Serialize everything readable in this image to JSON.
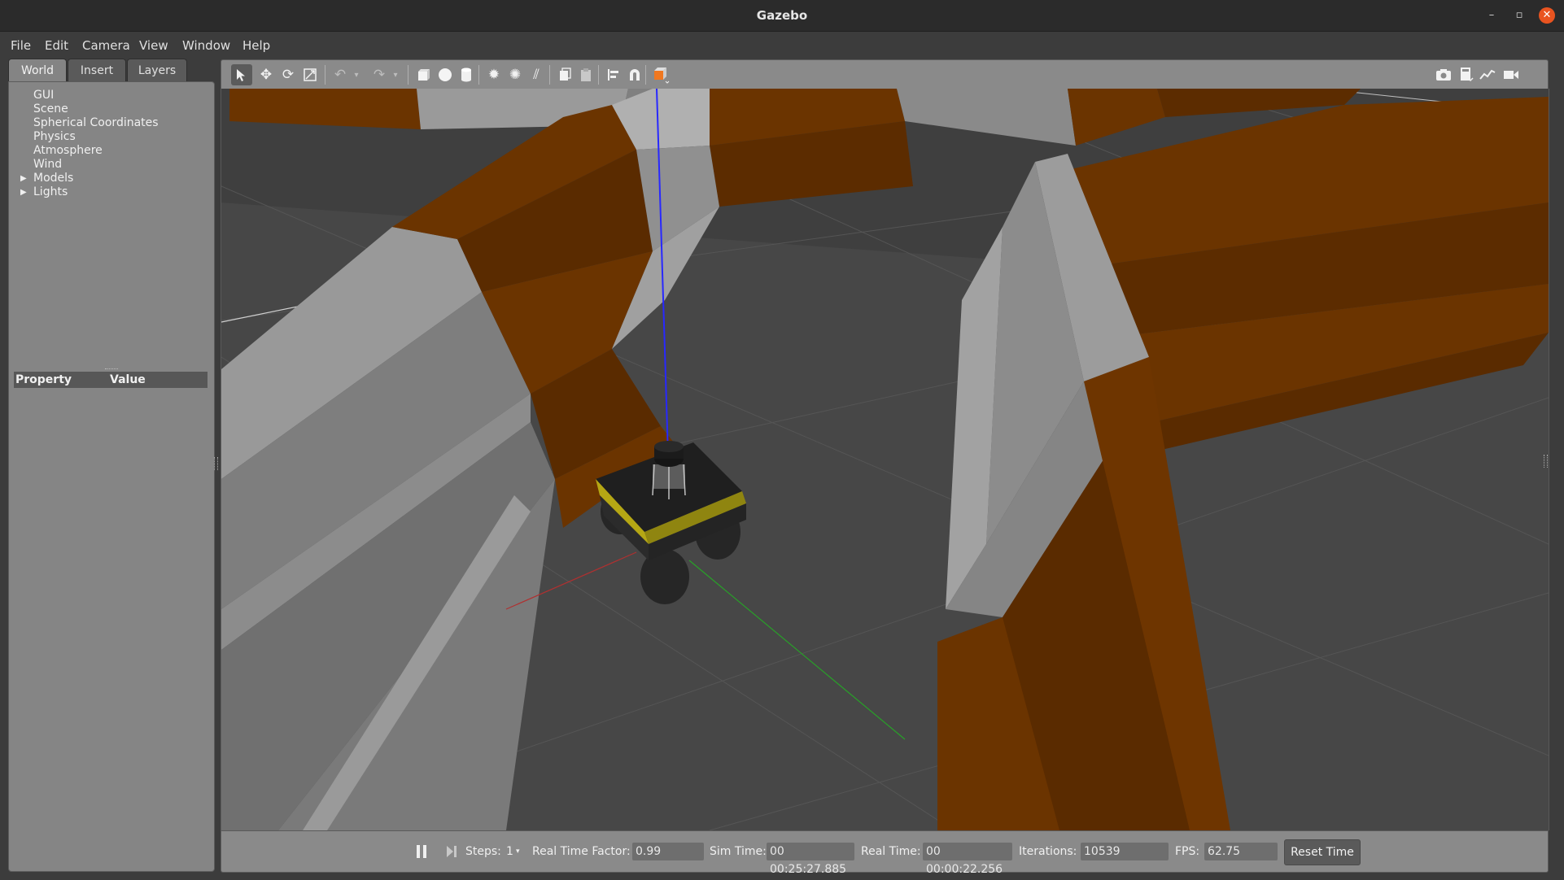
{
  "window": {
    "title": "Gazebo",
    "minimize": "–",
    "maximize": "▫",
    "close": "✕"
  },
  "menu": [
    "File",
    "Edit",
    "Camera",
    "View",
    "Window",
    "Help"
  ],
  "left_tabs": [
    "World",
    "Insert",
    "Layers"
  ],
  "active_tab": "World",
  "tree": {
    "items": [
      "GUI",
      "Scene",
      "Spherical Coordinates",
      "Physics",
      "Atmosphere",
      "Wind"
    ],
    "expandable": [
      "Models",
      "Lights"
    ]
  },
  "property_table": {
    "col_property": "Property",
    "col_value": "Value"
  },
  "toolbar_icons": [
    "select-arrow-icon",
    "translate-icon",
    "rotate-icon",
    "scale-icon",
    "undo-icon",
    "undo-dropdown-icon",
    "redo-icon",
    "redo-dropdown-icon",
    "box-icon",
    "sphere-icon",
    "cylinder-icon",
    "point-light-icon",
    "spot-light-icon",
    "directional-light-icon",
    "copy-icon",
    "paste-icon",
    "align-icon",
    "snap-icon",
    "view-angle-icon",
    "screenshot-icon",
    "log-icon",
    "plot-icon",
    "record-video-icon"
  ],
  "bottom": {
    "steps_label": "Steps:",
    "steps_value": "1",
    "rtf_label": "Real Time Factor:",
    "rtf_value": "0.99",
    "sim_time_label": "Sim Time:",
    "sim_time_value": "00 00:25:27.885",
    "real_time_label": "Real Time:",
    "real_time_value": "00 00:00:22.256",
    "iterations_label": "Iterations:",
    "iterations_value": "10539",
    "fps_label": "FPS:",
    "fps_value": "62.75",
    "reset_label": "Reset Time"
  },
  "colors": {
    "wall_orange": "#6b3400",
    "wall_gray": "#9a9a9a",
    "ground": "#4a4a4a",
    "robot_yellow": "#b5a714",
    "axis_x": "#b03030",
    "axis_y": "#28a028",
    "axis_z": "#2a2aff"
  }
}
